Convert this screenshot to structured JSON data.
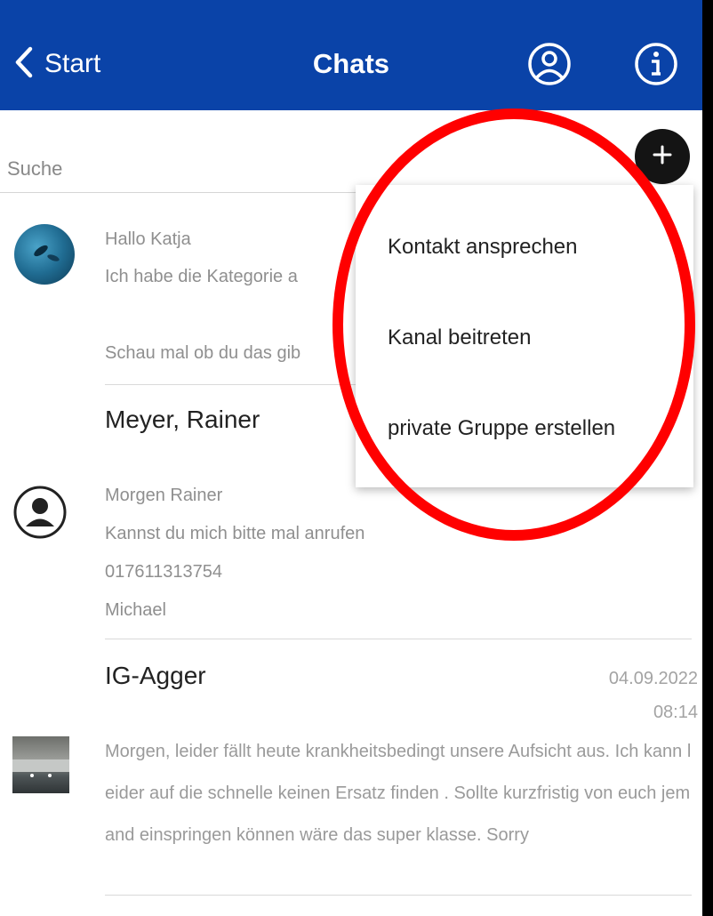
{
  "header": {
    "back_label": "Start",
    "title": "Chats",
    "background": "#0a43a8",
    "icons": [
      "chevron-left-icon",
      "user-circle-icon",
      "info-circle-icon"
    ]
  },
  "search": {
    "placeholder": "Suche"
  },
  "fab": {
    "icon": "plus-icon"
  },
  "chats": [
    {
      "name": "",
      "lines": [
        "Hallo Katja",
        "Ich habe die Kategorie a",
        "Schau mal ob du das gib"
      ],
      "avatar": "photo-avatar"
    },
    {
      "name": "Meyer, Rainer",
      "lines": [
        "Morgen Rainer",
        "Kannst du mich bitte mal anrufen",
        "017611313754",
        "Michael"
      ],
      "avatar": "person-placeholder-icon"
    },
    {
      "name": "IG-Agger",
      "date": "04.09.2022",
      "time": "08:14",
      "preview": "Morgen,  leider fällt heute krankheitsbedingt unsere Aufsicht aus. Ich kann leider auf die schnelle keinen Ersatz finden .  Sollte kurzfristig von euch jemand einspringen können wäre das super klasse.  Sorry",
      "avatar": "photo-avatar"
    }
  ],
  "menu": {
    "items": [
      "Kontakt ansprechen",
      "Kanal beitreten",
      "private Gruppe erstellen"
    ]
  },
  "annotation": {
    "color": "#ff0000",
    "shape": "ellipse"
  }
}
